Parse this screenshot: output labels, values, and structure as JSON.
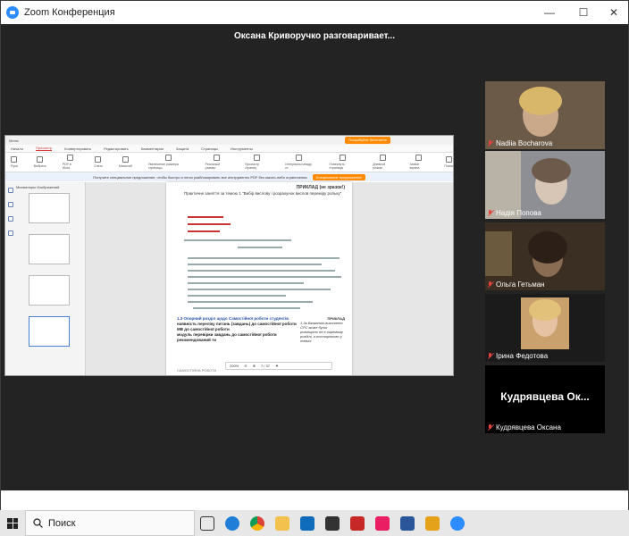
{
  "window": {
    "title": "Zoom Конференция"
  },
  "speaker_banner": "Оксана Криворучко разговаривает...",
  "shared_pdf": {
    "tabs": [
      "Начало",
      "Просмотр",
      "Конвертировать",
      "Редактировать",
      "Комментарии",
      "Защита",
      "Страницы",
      "Инструменты"
    ],
    "active_tab": "Просмотр",
    "title_badge": "Попробуйте бесплатно",
    "tools": [
      "Рука",
      "Выбрать",
      "PDF в Word",
      "Снять",
      "Масштаб",
      "Увеличение размера страницы",
      "Реальный размер",
      "Просмотр страниц",
      "Интервалы между ст.",
      "Повернуть страницы",
      "Дневной режим",
      "Захват экрана",
      "Поиск"
    ],
    "notice_text": "Получите специальное предложение, чтобы быстро и легко разблокировать все инструменты PDF без какого-либо ограничения",
    "notice_button": "Специальное предложение",
    "thumbs_label": "Миниатюры Изображений",
    "page_heading": "ПРИКЛАД (не зразок!)",
    "page_subtitle": "Практичне заняття за темою 1 \"Вибір вислову і розрахунок вислов переміру рольку\"",
    "section_title": "1.3 Опорний розділ щодо Самостійної роботи студентів",
    "section_lines": [
      "наявність переліку питань (завдань) до самостійної роботи",
      "МВ до самостійної роботи",
      "модуль перевірки завдань до самостійної роботи",
      "рекомендований ти"
    ],
    "note_heading": "ПРИКЛАД",
    "note_text": "1.3а Вказаним-виконання СРС може бути розміщено не в окремому розділі, а посторінково у темах",
    "page_footer": "САМОСТІЙНА РОБОТА",
    "zoom_level": "200%",
    "page_indicator": "7 / 37"
  },
  "participants": [
    {
      "name": "Nadiia Bocharova",
      "muted": true,
      "colors": [
        "#6b5a48",
        "#c9a98a"
      ]
    },
    {
      "name": "Надія Попова",
      "muted": true,
      "colors": [
        "#8d8f95",
        "#d7c6b6"
      ]
    },
    {
      "name": "Ольга Гетьман",
      "muted": true,
      "colors": [
        "#3b2e22",
        "#8a6c52"
      ]
    },
    {
      "name": "Ірина Федотова",
      "muted": true,
      "colors": [
        "#1b1b1b",
        "#caa06c"
      ]
    },
    {
      "name": "Кудрявцева Оксана",
      "muted": true,
      "display_text": "Кудрявцева  Ок..."
    }
  ],
  "taskbar": {
    "search_placeholder": "Поиск"
  }
}
